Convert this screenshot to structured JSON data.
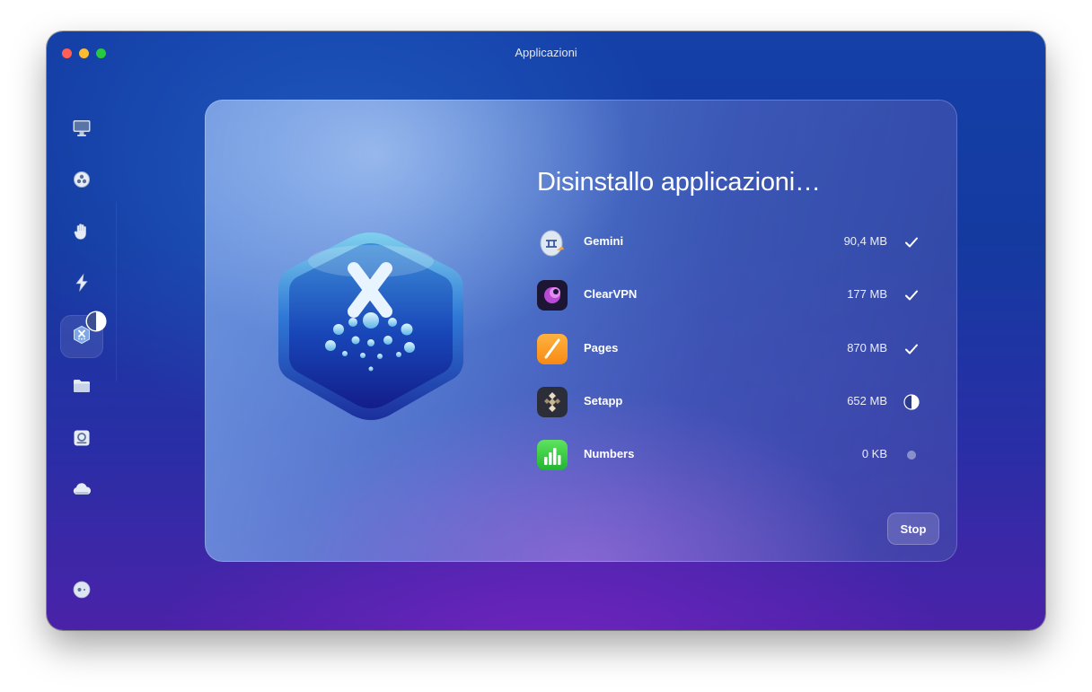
{
  "window": {
    "title": "Applicazioni"
  },
  "sidebar": {
    "items": [
      {
        "name": "sidebar-item-system-junk",
        "icon": "imac-icon",
        "active": false
      },
      {
        "name": "sidebar-item-malware",
        "icon": "biohazard-icon",
        "active": false
      },
      {
        "name": "sidebar-item-privacy",
        "icon": "hand-icon",
        "active": false
      },
      {
        "name": "sidebar-item-speed",
        "icon": "lightning-icon",
        "active": false
      },
      {
        "name": "sidebar-item-applications",
        "icon": "applications-icon",
        "active": true
      },
      {
        "name": "sidebar-item-my-clutter",
        "icon": "folder-icon",
        "active": false
      },
      {
        "name": "sidebar-item-space-lens",
        "icon": "hard-drive-icon",
        "active": false
      },
      {
        "name": "sidebar-item-cloud",
        "icon": "cloud-icon",
        "active": false
      }
    ],
    "footer_icon": "assistant-icon"
  },
  "main": {
    "title": "Disinstallo applicazioni…",
    "apps": [
      {
        "name": "Gemini",
        "size": "90,4 MB",
        "status": "done",
        "icon": "gemini-icon"
      },
      {
        "name": "ClearVPN",
        "size": "177 MB",
        "status": "done",
        "icon": "clearvpn-icon"
      },
      {
        "name": "Pages",
        "size": "870 MB",
        "status": "done",
        "icon": "pages-icon"
      },
      {
        "name": "Setapp",
        "size": "652 MB",
        "status": "in-progress",
        "progress": 0.5,
        "icon": "setapp-icon"
      },
      {
        "name": "Numbers",
        "size": "0 KB",
        "status": "pending",
        "icon": "numbers-icon"
      }
    ],
    "stop_label": "Stop"
  },
  "colors": {
    "traffic_red": "#fe5f57",
    "traffic_yellow": "#febc2e",
    "traffic_green": "#28c840"
  }
}
